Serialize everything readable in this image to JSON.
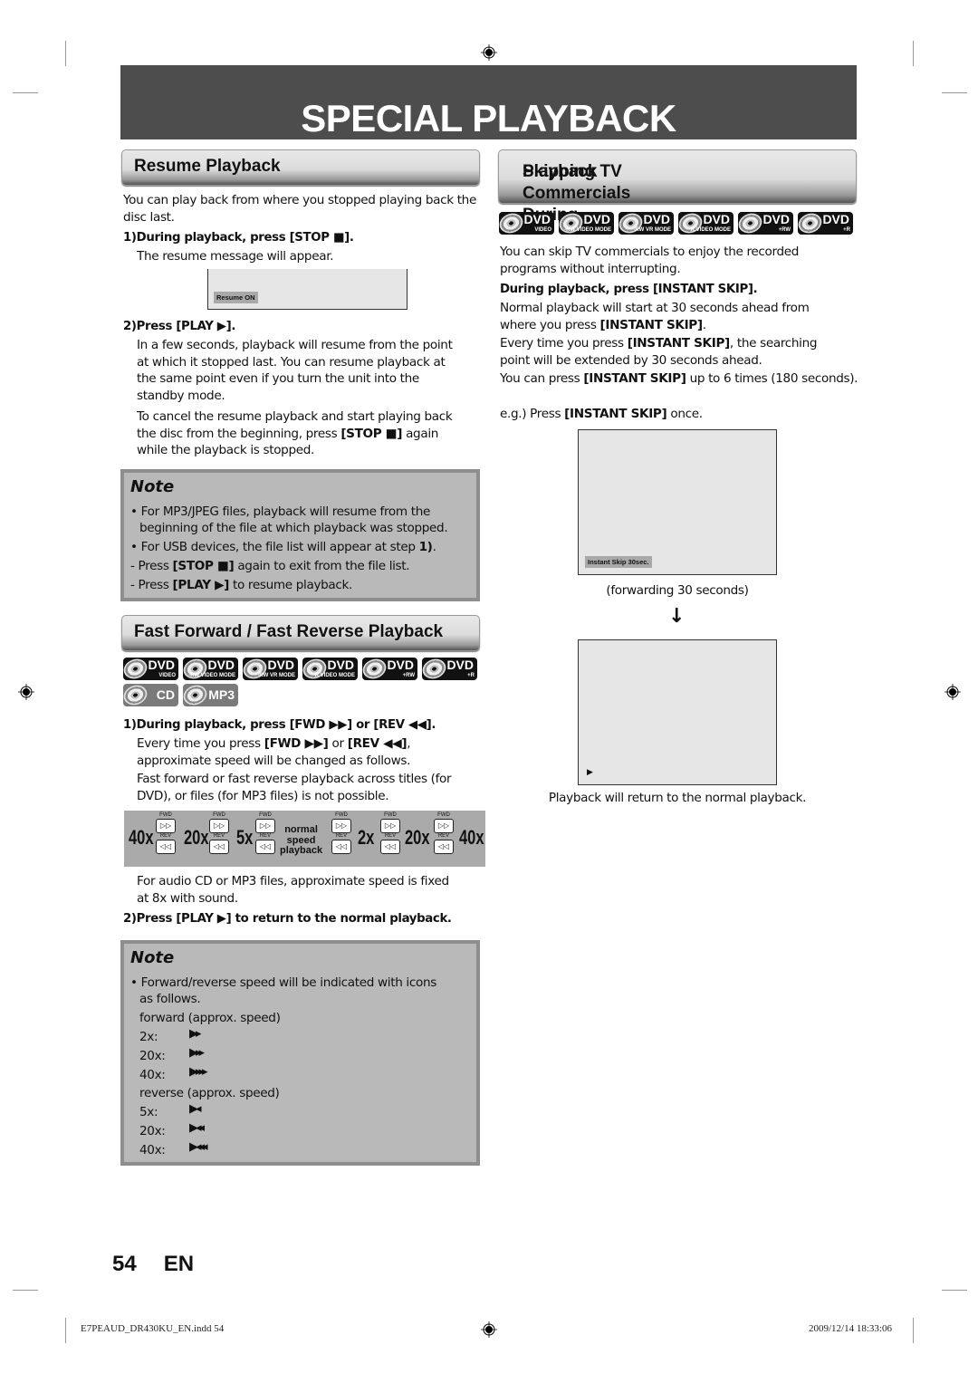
{
  "banner": {
    "title": "SPECIAL PLAYBACK"
  },
  "resume": {
    "heading": "Resume Playback",
    "intro": "You can play back from where you stopped playing back the disc last.",
    "step1": {
      "num": "1)",
      "text": "During playback, press [STOP ■].",
      "detail": "The resume message will appear."
    },
    "screen_osd": "Resume ON",
    "step2": {
      "num": "2)",
      "text": "Press [PLAY ▶].",
      "detail1": [
        "In a few seconds, playback will resume from the point",
        "at which it stopped last. You can resume playback at",
        "the same point even if you turn the unit into the",
        "standby mode."
      ],
      "detail2_a": "To cancel the resume playback and start playing back",
      "detail2_b_pre": "the disc from the beginning, press ",
      "detail2_b_bold": "[STOP ■]",
      "detail2_b_post": " again",
      "detail2_c": "while the playback is stopped."
    },
    "note": {
      "title": "Note",
      "items": [
        {
          "marker": "•",
          "text": "For MP3/JPEG files, playback will resume from the"
        },
        {
          "marker": "",
          "text": "beginning of the file at which playback was stopped."
        },
        {
          "marker": "•",
          "pre": "For USB devices, the file list will appear at step ",
          "bold": "1)",
          "post": "."
        },
        {
          "marker": "-",
          "pre": "Press ",
          "bold": "[STOP ■]",
          "post": " again to exit from the file list."
        },
        {
          "marker": "-",
          "pre": "Press ",
          "bold": "[PLAY ▶]",
          "post": " to resume playback."
        }
      ]
    }
  },
  "ff": {
    "heading": "Fast Forward / Fast Reverse Playback",
    "badges": [
      {
        "icon": "dvd-video-icon",
        "main": "DVD",
        "sub": "VIDEO"
      },
      {
        "icon": "dvd-rw-video-mode-icon",
        "main": "DVD",
        "sub": "-RW VIDEO MODE"
      },
      {
        "icon": "dvd-rw-vr-mode-icon",
        "main": "DVD",
        "sub": "-RW VR MODE"
      },
      {
        "icon": "dvd-r-video-mode-icon",
        "main": "DVD",
        "sub": "-R VIDEO MODE"
      },
      {
        "icon": "dvd-plus-rw-icon",
        "main": "DVD",
        "sub": "+RW"
      },
      {
        "icon": "dvd-plus-r-icon",
        "main": "DVD",
        "sub": "+R"
      }
    ],
    "badges2": [
      {
        "icon": "cd-icon",
        "main": "CD"
      },
      {
        "icon": "mp3-icon",
        "main": "MP3"
      }
    ],
    "step1": {
      "num": "1)",
      "text": "During playback, press [FWD ▶▶] or [REV ◀◀].",
      "line1_pre": "Every time you press ",
      "line1_b1": "[FWD ▶▶]",
      "line1_mid": " or ",
      "line1_b2": "[REV ◀◀]",
      "line1_post": ",",
      "line2": "approximate speed will be changed as follows.",
      "line3": "Fast forward or fast reverse playback across titles (for",
      "line4": "DVD), or files (for MP3 files) is not possible."
    },
    "speed_chart": {
      "speeds_left": [
        "40x",
        "20x",
        "5x"
      ],
      "center": [
        "normal",
        "speed",
        "playback"
      ],
      "speeds_right": [
        "2x",
        "20x",
        "40x"
      ],
      "fwd_label": "FWD",
      "rev_label": "REV",
      "fwd_key": "▷▷",
      "rev_key": "◁◁"
    },
    "audio_note": [
      "For audio CD or MP3 files, approximate speed is fixed",
      "at 8x with sound."
    ],
    "step2": {
      "num": "2)",
      "text": "Press [PLAY ▶] to return to the normal playback."
    },
    "note": {
      "title": "Note",
      "intro": [
        "Forward/reverse speed will be indicated with icons",
        "as follows."
      ],
      "forward_label": "forward (approx. speed)",
      "forward": [
        {
          "speed": "2x:",
          "icon": "▶▸"
        },
        {
          "speed": "20x:",
          "icon": "▶▸▸"
        },
        {
          "speed": "40x:",
          "icon": "▶▸▸▸"
        }
      ],
      "reverse_label": "reverse (approx. speed)",
      "reverse": [
        {
          "speed": "5x:",
          "icon": "▶◂"
        },
        {
          "speed": "20x:",
          "icon": "▶◂◂"
        },
        {
          "speed": "40x:",
          "icon": "▶◂◂◂"
        }
      ]
    }
  },
  "skip": {
    "heading_1": "Skipping TV Commercials During",
    "heading_2": "Playback",
    "intro": [
      "You can skip TV commercials to enjoy the recorded",
      "programs without interrupting."
    ],
    "step": "During playback, press [INSTANT SKIP].",
    "p1_a_pre": "Normal playback will start at 30 seconds ahead from",
    "p1_b_pre": "where you press ",
    "p1_b_bold": "[INSTANT SKIP]",
    "p1_b_post": ".",
    "p2_a_pre": "Every time you press ",
    "p2_a_bold": "[INSTANT SKIP]",
    "p2_a_post": ", the searching",
    "p2_b": "point will be extended by 30 seconds ahead.",
    "p3_pre": "You can press ",
    "p3_bold": "[INSTANT SKIP]",
    "p3_post": " up to 6 times (180 seconds).",
    "eg_pre": "e.g.) Press ",
    "eg_bold": "[INSTANT SKIP]",
    "eg_post": " once.",
    "screen1_osd": "Instant Skip 30sec.",
    "caption1": "(forwarding 30 seconds)",
    "arrow": "↓",
    "screen2_osd": "▶",
    "caption2": "Playback will return to the normal playback."
  },
  "footer": {
    "page_num": "54",
    "lang": "EN",
    "slug_file": "E7PEAUD_DR430KU_EN.indd   54",
    "slug_date": "2009/12/14   18:33:06"
  }
}
